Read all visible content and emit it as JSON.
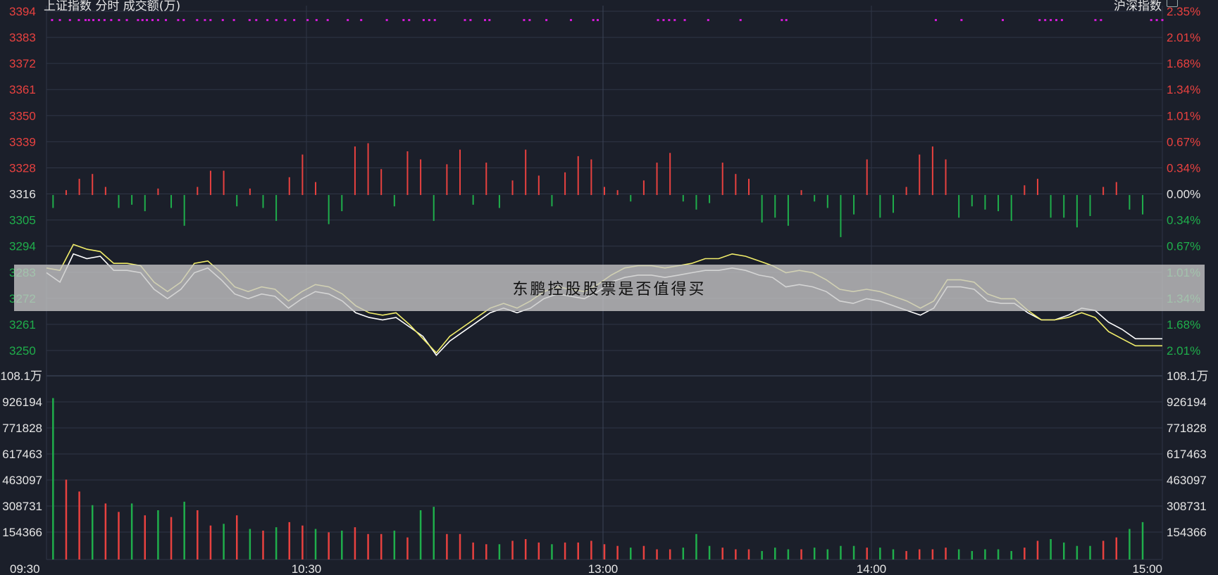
{
  "header": {
    "left_title": "上证指数  分时 成交额(万)",
    "right_title": "沪深指数"
  },
  "watermark": "东鹏控股股票是否值得买",
  "colors": {
    "background": "#1b1f2a",
    "grid": "#2f3646",
    "up": "#e8413f",
    "down": "#1fae4b",
    "price_line": "#ffffff",
    "avg_line": "#f2ee6a",
    "signal_dots": "#d21ad6"
  },
  "chart_data": [
    {
      "type": "line",
      "title": "上证指数 分时",
      "x_ticks": [
        "09:30",
        "10:30",
        "13:00",
        "14:00",
        "15:00"
      ],
      "y_left_ticks": [
        "3394",
        "3383",
        "3372",
        "3361",
        "3350",
        "3339",
        "3328",
        "3316",
        "3305",
        "3294",
        "3283",
        "3272",
        "3261",
        "3250"
      ],
      "y_right_ticks": [
        "2.35%",
        "2.01%",
        "1.68%",
        "1.34%",
        "1.01%",
        "0.67%",
        "0.34%",
        "0.00%",
        "0.34%",
        "0.67%",
        "1.01%",
        "1.34%",
        "1.68%",
        "2.01%"
      ],
      "ylim": [
        3250,
        3394
      ],
      "base": 3316,
      "series": [
        {
          "values": [
            3283,
            3279,
            3291,
            3289,
            3290,
            3284,
            3284,
            3283,
            3276,
            3272,
            3276,
            3283,
            3285,
            3280,
            3274,
            3272,
            3274,
            3273,
            3268,
            3272,
            3275,
            3274,
            3271,
            3266,
            3264,
            3263,
            3264,
            3260,
            3256,
            3248,
            3254,
            3258,
            3262,
            3266,
            3268,
            3266,
            3268,
            3272,
            3274,
            3273,
            3272,
            3275,
            3279,
            3281,
            3282,
            3282,
            3281,
            3282,
            3283,
            3284,
            3284,
            3285,
            3284,
            3282,
            3281,
            3277,
            3278,
            3277,
            3275,
            3271,
            3270,
            3272,
            3271,
            3269,
            3267,
            3265,
            3268,
            3277,
            3277,
            3276,
            3271,
            3270,
            3270,
            3266,
            3263,
            3263,
            3265,
            3268,
            3267,
            3262,
            3259,
            3255,
            3255,
            3255
          ]
        },
        {
          "values": [
            3285,
            3284,
            3295,
            3293,
            3292,
            3287,
            3287,
            3286,
            3279,
            3275,
            3279,
            3287,
            3288,
            3283,
            3277,
            3275,
            3277,
            3276,
            3271,
            3275,
            3278,
            3277,
            3274,
            3269,
            3266,
            3265,
            3266,
            3261,
            3255,
            3249,
            3256,
            3260,
            3264,
            3268,
            3270,
            3268,
            3271,
            3275,
            3277,
            3276,
            3275,
            3278,
            3282,
            3285,
            3286,
            3286,
            3285,
            3286,
            3287,
            3289,
            3289,
            3291,
            3290,
            3288,
            3286,
            3283,
            3284,
            3283,
            3280,
            3276,
            3275,
            3276,
            3275,
            3273,
            3271,
            3268,
            3271,
            3280,
            3280,
            3279,
            3274,
            3272,
            3272,
            3267,
            3263,
            3263,
            3264,
            3266,
            3264,
            3258,
            3255,
            3252,
            3252,
            3252
          ]
        }
      ],
      "volume_ratio_bars": [
        -8,
        3,
        10,
        13,
        5,
        -8,
        -6,
        -10,
        4,
        -8,
        -19,
        5,
        15,
        15,
        -7,
        4,
        -8,
        -16,
        11,
        25,
        8,
        -18,
        -10,
        30,
        32,
        16,
        -7,
        27,
        22,
        -16,
        19,
        28,
        -6,
        20,
        -8,
        9,
        28,
        12,
        -7,
        14,
        24,
        22,
        5,
        3,
        -4,
        9,
        20,
        26,
        -4,
        -9,
        -5,
        20,
        13,
        10,
        -17,
        -14,
        -19,
        3,
        -4,
        -8,
        -26,
        -12,
        22,
        -14,
        -11,
        5,
        25,
        30,
        22,
        -14,
        -7,
        -9,
        -10,
        -16,
        6,
        10,
        -14,
        -14,
        -20,
        -13,
        5,
        8,
        -9,
        -12,
        0
      ],
      "signal_dots_x": [
        0.005,
        0.012,
        0.021,
        0.029,
        0.035,
        0.038,
        0.042,
        0.047,
        0.052,
        0.058,
        0.065,
        0.072,
        0.082,
        0.086,
        0.09,
        0.095,
        0.1,
        0.107,
        0.118,
        0.123,
        0.135,
        0.142,
        0.147,
        0.158,
        0.168,
        0.182,
        0.188,
        0.198,
        0.206,
        0.214,
        0.222,
        0.234,
        0.242,
        0.252,
        0.27,
        0.282,
        0.305,
        0.32,
        0.325,
        0.338,
        0.343,
        0.348,
        0.375,
        0.38,
        0.393,
        0.397,
        0.428,
        0.433,
        0.448,
        0.47,
        0.49,
        0.494,
        0.548,
        0.553,
        0.558,
        0.563,
        0.572,
        0.593,
        0.622,
        0.659,
        0.663,
        0.797,
        0.82,
        0.857,
        0.89,
        0.895,
        0.9,
        0.905,
        0.91,
        0.94,
        0.945,
        0.99,
        0.995,
        1.0
      ]
    },
    {
      "type": "bar",
      "title": "成交额(万)",
      "y_left_ticks": [
        "108.1万",
        "926194",
        "771828",
        "617463",
        "463097",
        "308731",
        "154366"
      ],
      "y_right_ticks": [
        "108.1万",
        "926194",
        "771828",
        "617463",
        "463097",
        "308731",
        "154366"
      ],
      "ylim": [
        0,
        1081000
      ],
      "values": [
        950000,
        470000,
        400000,
        320000,
        330000,
        280000,
        330000,
        260000,
        290000,
        250000,
        340000,
        290000,
        200000,
        210000,
        260000,
        180000,
        170000,
        190000,
        220000,
        200000,
        180000,
        160000,
        170000,
        190000,
        150000,
        150000,
        170000,
        130000,
        290000,
        310000,
        150000,
        150000,
        100000,
        90000,
        90000,
        110000,
        120000,
        100000,
        90000,
        100000,
        100000,
        110000,
        90000,
        80000,
        70000,
        80000,
        60000,
        60000,
        70000,
        150000,
        80000,
        70000,
        60000,
        60000,
        50000,
        70000,
        60000,
        60000,
        70000,
        60000,
        80000,
        80000,
        70000,
        70000,
        60000,
        50000,
        60000,
        60000,
        70000,
        60000,
        50000,
        60000,
        60000,
        50000,
        70000,
        110000,
        120000,
        100000,
        80000,
        80000,
        110000,
        130000,
        180000,
        220000,
        0
      ],
      "colors": [
        "down",
        "up",
        "up",
        "down",
        "up",
        "up",
        "down",
        "up",
        "down",
        "up",
        "down",
        "up",
        "up",
        "down",
        "up",
        "down",
        "up",
        "down",
        "up",
        "up",
        "down",
        "up",
        "down",
        "up",
        "up",
        "up",
        "down",
        "up",
        "down",
        "down",
        "up",
        "up",
        "up",
        "up",
        "down",
        "up",
        "up",
        "up",
        "down",
        "up",
        "up",
        "up",
        "up",
        "up",
        "down",
        "up",
        "up",
        "up",
        "down",
        "down",
        "down",
        "up",
        "up",
        "up",
        "down",
        "down",
        "down",
        "up",
        "down",
        "down",
        "down",
        "down",
        "up",
        "down",
        "down",
        "up",
        "up",
        "up",
        "up",
        "down",
        "down",
        "down",
        "down",
        "down",
        "up",
        "up",
        "down",
        "down",
        "down",
        "down",
        "up",
        "up",
        "down",
        "down",
        "up"
      ]
    }
  ]
}
